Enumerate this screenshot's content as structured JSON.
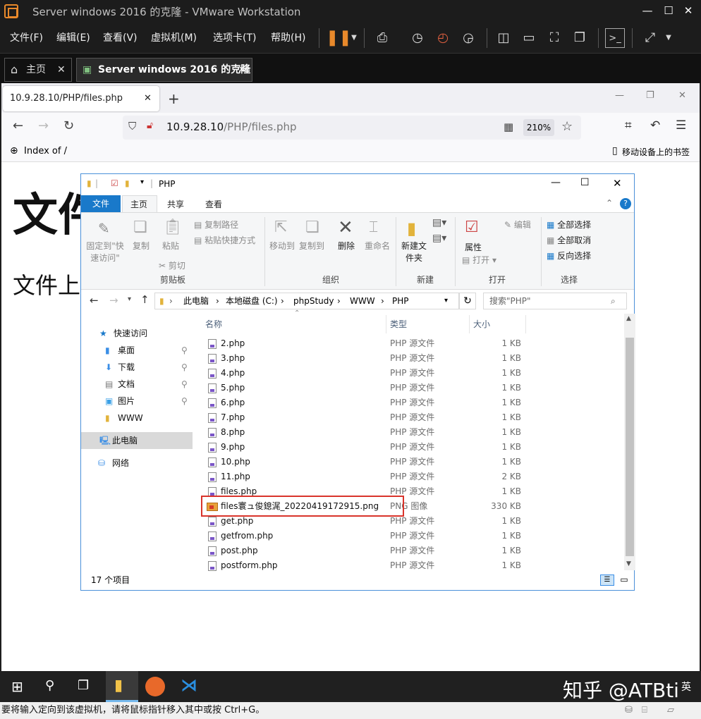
{
  "vmware": {
    "title": "Server windows 2016 的克隆 - VMware Workstation",
    "menu": [
      "文件(F)",
      "编辑(E)",
      "查看(V)",
      "虚拟机(M)",
      "选项卡(T)",
      "帮助(H)"
    ],
    "tabs": [
      {
        "label": "主页"
      },
      {
        "label": "Server windows 2016 的克隆"
      }
    ],
    "status_text": "要将输入定向到该虚拟机，请将鼠标指针移入其中或按 Ctrl+G。"
  },
  "firefox": {
    "tab_title": "10.9.28.10/PHP/files.php",
    "url_host": "10.9.28.10",
    "url_path": "/PHP/files.php",
    "zoom": "210%",
    "bookmark": "Index of /",
    "mobile_bookmarks": "移动设备上的书签",
    "page_heading": "文件",
    "page_text": "文件上"
  },
  "explorer": {
    "title": "PHP",
    "tabs": {
      "file": "文件",
      "home": "主页",
      "share": "共享",
      "view": "查看"
    },
    "ribbon": {
      "pin": "固定到\"快速访问\"",
      "copy": "复制",
      "paste": "粘贴",
      "copy_path": "复制路径",
      "paste_shortcut": "粘贴快捷方式",
      "cut": "剪切",
      "clipboard": "剪贴板",
      "move_to": "移动到",
      "copy_to": "复制到",
      "delete": "删除",
      "rename": "重命名",
      "organize": "组织",
      "new_folder": "新建文件夹",
      "new": "新建",
      "properties": "属性",
      "open": "打开",
      "edit": "编辑",
      "open_group": "打开",
      "select_all": "全部选择",
      "select_none": "全部取消",
      "invert": "反向选择",
      "select": "选择"
    },
    "breadcrumb": [
      "此电脑",
      "本地磁盘 (C:)",
      "phpStudy",
      "WWW",
      "PHP"
    ],
    "search_placeholder": "搜索\"PHP\"",
    "nav": {
      "quick_access": "快速访问",
      "desktop": "桌面",
      "downloads": "下载",
      "documents": "文档",
      "pictures": "图片",
      "www": "WWW",
      "this_pc": "此电脑",
      "network": "网络"
    },
    "columns": {
      "name": "名称",
      "type": "类型",
      "size": "大小"
    },
    "files": [
      {
        "name": "2.php",
        "type": "PHP 源文件",
        "size": "1 KB"
      },
      {
        "name": "3.php",
        "type": "PHP 源文件",
        "size": "1 KB"
      },
      {
        "name": "4.php",
        "type": "PHP 源文件",
        "size": "1 KB"
      },
      {
        "name": "5.php",
        "type": "PHP 源文件",
        "size": "1 KB"
      },
      {
        "name": "6.php",
        "type": "PHP 源文件",
        "size": "1 KB"
      },
      {
        "name": "7.php",
        "type": "PHP 源文件",
        "size": "1 KB"
      },
      {
        "name": "8.php",
        "type": "PHP 源文件",
        "size": "1 KB"
      },
      {
        "name": "9.php",
        "type": "PHP 源文件",
        "size": "1 KB"
      },
      {
        "name": "10.php",
        "type": "PHP 源文件",
        "size": "1 KB"
      },
      {
        "name": "11.php",
        "type": "PHP 源文件",
        "size": "2 KB"
      },
      {
        "name": "files.php",
        "type": "PHP 源文件",
        "size": "1 KB"
      },
      {
        "name": "files寰ュ俊鎴浘_20220419172915.png",
        "type": "PNG 图像",
        "size": "330 KB"
      },
      {
        "name": "get.php",
        "type": "PHP 源文件",
        "size": "1 KB"
      },
      {
        "name": "getfrom.php",
        "type": "PHP 源文件",
        "size": "1 KB"
      },
      {
        "name": "post.php",
        "type": "PHP 源文件",
        "size": "1 KB"
      },
      {
        "name": "postform.php",
        "type": "PHP 源文件",
        "size": "1 KB"
      }
    ],
    "status": "17 个项目"
  },
  "taskbar": {
    "watermark": "知乎 @ATBti",
    "ime": "英"
  },
  "colors": {
    "accent": "#1979ca",
    "highlight_box": "#d9342b",
    "vmware_pause": "#e8892b"
  }
}
